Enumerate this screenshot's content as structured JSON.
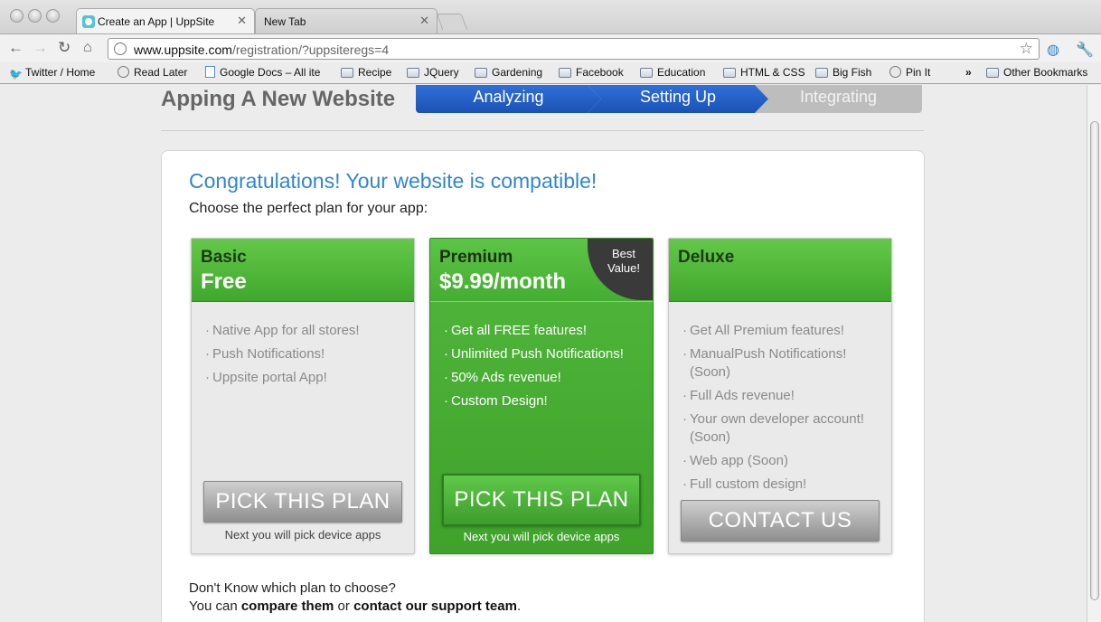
{
  "browser": {
    "tabs": [
      {
        "title": "Create an App | UppSite",
        "active": true
      },
      {
        "title": "New Tab",
        "active": false
      }
    ],
    "url": {
      "host": "www.uppsite.com",
      "path": "/registration/?uppsiteregs=4"
    }
  },
  "bookmarks": [
    {
      "label": "Twitter / Home",
      "icon": "twitter-bird-icon"
    },
    {
      "label": "Read Later",
      "icon": "globe-icon"
    },
    {
      "label": "Google Docs – All ite",
      "icon": "docs-icon"
    },
    {
      "label": "Recipe",
      "icon": "folder-icon"
    },
    {
      "label": "JQuery",
      "icon": "folder-icon"
    },
    {
      "label": "Gardening",
      "icon": "folder-icon"
    },
    {
      "label": "Facebook",
      "icon": "folder-icon"
    },
    {
      "label": "Education",
      "icon": "folder-icon"
    },
    {
      "label": "HTML & CSS",
      "icon": "folder-icon"
    },
    {
      "label": "Big Fish",
      "icon": "folder-icon"
    },
    {
      "label": "Pin It",
      "icon": "globe-icon"
    }
  ],
  "bookmarks_overflow": "»",
  "other_bookmarks": "Other Bookmarks",
  "page": {
    "heading": "Apping A New Website",
    "steps": [
      {
        "label": "Analyzing",
        "state": "done"
      },
      {
        "label": "Setting Up",
        "state": "current"
      },
      {
        "label": "Integrating",
        "state": "pending"
      }
    ],
    "congrats": "Congratulations! Your website is compatible!",
    "subtitle": "Choose the perfect plan for your app:",
    "plans": [
      {
        "name": "Basic",
        "price": "Free",
        "features": [
          "Native App for all stores!",
          "Push Notifications!",
          "Uppsite portal App!"
        ],
        "button": "PICK THIS PLAN",
        "note": "Next you will pick device apps"
      },
      {
        "name": "Premium",
        "price": "$9.99/month",
        "badge": "Best Value!",
        "features": [
          "Get all FREE features!",
          "Unlimited Push Notifications!",
          "50% Ads revenue!",
          "Custom Design!"
        ],
        "button": "PICK THIS PLAN",
        "note": "Next you will pick device apps"
      },
      {
        "name": "Deluxe",
        "price": "",
        "features": [
          "Get All Premium features!",
          "ManualPush Notifications! (Soon)",
          "Full Ads revenue!",
          "Your own developer account! (Soon)",
          "Web app (Soon)",
          "Full custom design!"
        ],
        "button": "CONTACT US"
      }
    ],
    "help": {
      "line1": "Don't Know which plan to choose?",
      "prefix": "You can ",
      "compare": "compare them",
      "middle": " or ",
      "contact": "contact our support team",
      "suffix": "."
    }
  },
  "colors": {
    "brand_blue": "#2f86cf",
    "plan_green": "#4cb538",
    "step_blue": "#1c52b5"
  }
}
